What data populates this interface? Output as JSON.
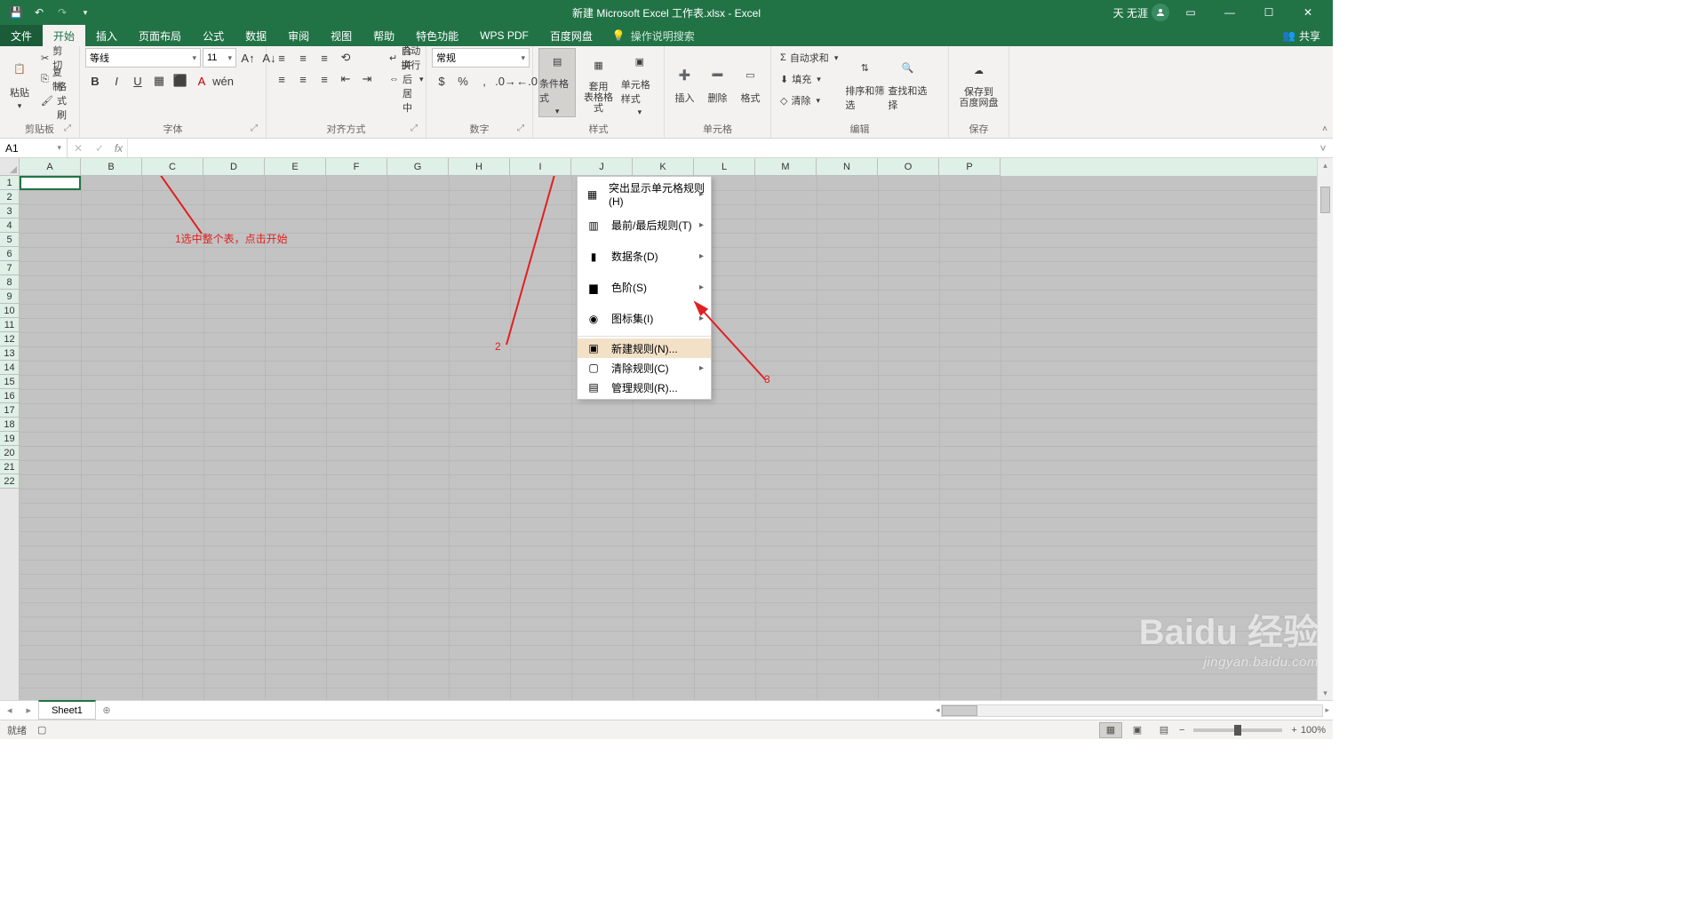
{
  "titlebar": {
    "title": "新建 Microsoft Excel 工作表.xlsx - Excel",
    "user": "天 无涯",
    "share": "共享"
  },
  "tabs": {
    "file": "文件",
    "home": "开始",
    "insert": "插入",
    "layout": "页面布局",
    "formulas": "公式",
    "data": "数据",
    "review": "审阅",
    "view": "视图",
    "help": "帮助",
    "special": "特色功能",
    "wps": "WPS PDF",
    "baidu": "百度网盘",
    "tell": "操作说明搜索"
  },
  "ribbon": {
    "clipboard": {
      "paste": "粘贴",
      "cut": "剪切",
      "copy": "复制",
      "painter": "格式刷",
      "label": "剪贴板"
    },
    "font": {
      "name": "等线",
      "size": "11",
      "label": "字体"
    },
    "align": {
      "wrap": "自动换行",
      "merge": "合并后居中",
      "label": "对齐方式"
    },
    "number": {
      "format": "常规",
      "label": "数字"
    },
    "styles": {
      "cond": "条件格式",
      "table": "套用\n表格格式",
      "cell": "单元格样式",
      "label": "样式"
    },
    "cells": {
      "insert": "插入",
      "delete": "删除",
      "format": "格式",
      "label": "单元格"
    },
    "editing": {
      "sum": "自动求和",
      "fill": "填充",
      "clear": "清除",
      "sort": "排序和筛选",
      "find": "查找和选择",
      "label": "编辑"
    },
    "save": {
      "btn": "保存到\n百度网盘",
      "label": "保存"
    }
  },
  "dropdown": {
    "highlight": "突出显示单元格规则(H)",
    "toprules": "最前/最后规则(T)",
    "databars": "数据条(D)",
    "colorscales": "色阶(S)",
    "iconsets": "图标集(I)",
    "newrule": "新建规则(N)...",
    "clearrules": "清除规则(C)",
    "managerules": "管理规则(R)..."
  },
  "namebox": "A1",
  "columns": [
    "A",
    "B",
    "C",
    "D",
    "E",
    "F",
    "G",
    "H",
    "I",
    "J",
    "K",
    "L",
    "M",
    "N",
    "O",
    "P"
  ],
  "rows_visible": 22,
  "sheet": {
    "name": "Sheet1"
  },
  "status": {
    "ready": "就绪",
    "zoom": "100%"
  },
  "annotations": {
    "a1": "1选中整个表，点击开始",
    "a2": "2",
    "a3": "3"
  },
  "watermark": {
    "main": "Baidu 经验",
    "sub": "jingyan.baidu.com"
  }
}
